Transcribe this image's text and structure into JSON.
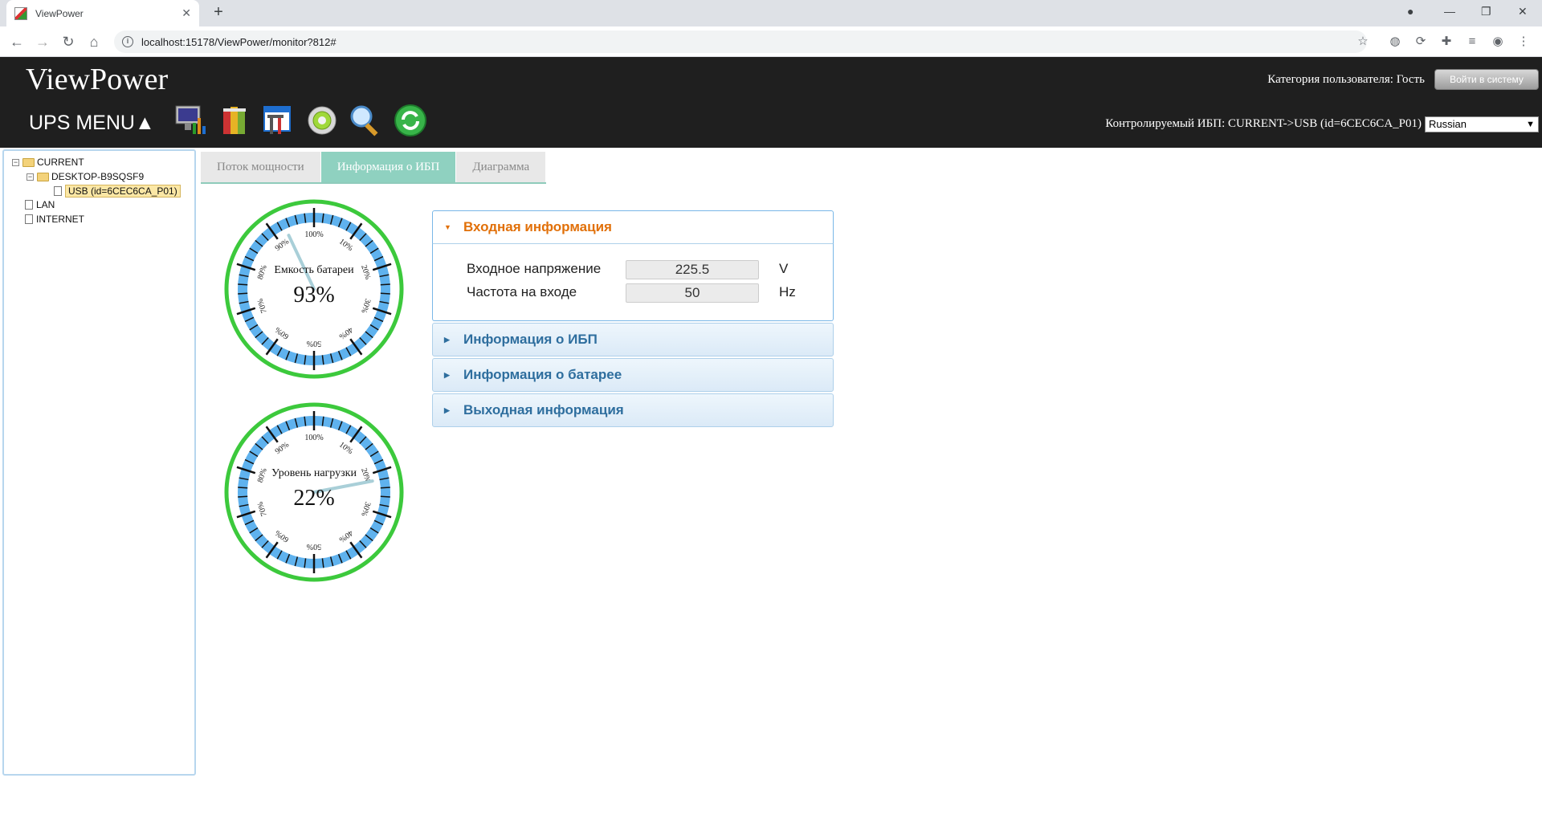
{
  "browser": {
    "tab_title": "ViewPower",
    "url": "localhost:15178/ViewPower/monitor?812#"
  },
  "header": {
    "logo": "ViewPower",
    "ups_menu": "UPS MENU▲",
    "user_category": "Категория пользователя: Гость",
    "login_button": "Войти в систему",
    "monitored_ups": "Контролируемый ИБП: CURRENT->USB (id=6CEC6CA_P01)",
    "language": "Russian"
  },
  "tree": {
    "current": "CURRENT",
    "desktop": "DESKTOP-B9SQSF9",
    "usb": "USB (id=6CEC6CA_P01)",
    "lan": "LAN",
    "internet": "INTERNET"
  },
  "tabs": {
    "power_flow": "Поток мощности",
    "ups_info": "Информация о ИБП",
    "chart": "Диаграмма"
  },
  "gauges": [
    {
      "label": "Емкость батареи",
      "value_text": "93%",
      "value": 93
    },
    {
      "label": "Уровень нагрузки",
      "value_text": "22%",
      "value": 22
    }
  ],
  "gauge_ticks": [
    "100%",
    "10%",
    "20%",
    "30%",
    "40%",
    "50%",
    "60%",
    "70%",
    "80%",
    "90%"
  ],
  "accordion": {
    "input_title": "Входная информация",
    "input_voltage_label": "Входное напряжение",
    "input_voltage_value": "225.5",
    "input_voltage_unit": "V",
    "input_freq_label": "Частота на входе",
    "input_freq_value": "50",
    "input_freq_unit": "Hz",
    "ups_title": "Информация о ИБП",
    "battery_title": "Информация о батарее",
    "output_title": "Выходная информация"
  },
  "colors": {
    "gauge_ring": "#3cc93c",
    "gauge_band": "#5fb2ee",
    "needle": "#a9cfd8"
  }
}
